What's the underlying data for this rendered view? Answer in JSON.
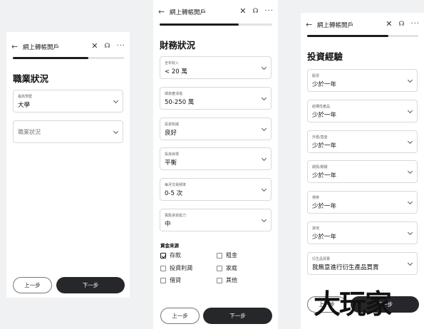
{
  "common": {
    "header_title": "網上轉帳開戶",
    "back_glyph": "←",
    "close_glyph": "✕",
    "support_glyph": "☊",
    "more_glyph": "···",
    "prev_label": "上一步",
    "next_label": "下一步"
  },
  "screen1": {
    "progress": 0.68,
    "section_title": "職業狀況",
    "fields": [
      {
        "label": "最高學歷",
        "value": "大學"
      },
      {
        "placeholder": "職業狀況"
      }
    ]
  },
  "screen2": {
    "progress": 0.7,
    "section_title": "財務狀況",
    "fields": [
      {
        "label": "全年收入",
        "value": "< 20 萬"
      },
      {
        "label": "總資產淨值",
        "value": "50-250 萬"
      },
      {
        "label": "投資知識",
        "value": "良好"
      },
      {
        "label": "投資目標",
        "value": "平衡"
      },
      {
        "label": "每月交易頻率",
        "value": "0-5 次"
      },
      {
        "label": "風險承受能力",
        "value": "中"
      }
    ],
    "fund_source_title": "資金來源",
    "fund_sources": [
      {
        "label": "存款",
        "checked": true
      },
      {
        "label": "租金",
        "checked": false
      },
      {
        "label": "投資利潤",
        "checked": false
      },
      {
        "label": "家庭",
        "checked": false
      },
      {
        "label": "借貸",
        "checked": false
      },
      {
        "label": "其他",
        "checked": false
      }
    ]
  },
  "screen3": {
    "progress": 0.73,
    "section_title": "投資經驗",
    "fields": [
      {
        "label": "股票",
        "value": "少於一年"
      },
      {
        "label": "結構性產品",
        "value": "少於一年"
      },
      {
        "label": "外匯/基金",
        "value": "少於一年"
      },
      {
        "label": "期貨/期權",
        "value": "少於一年"
      },
      {
        "label": "債券",
        "value": "少於一年"
      },
      {
        "label": "其他",
        "value": "少於一年"
      },
      {
        "label": "衍生品買賣",
        "value": "我無意進行衍生產品買賣"
      }
    ]
  },
  "watermark": "大玩家"
}
